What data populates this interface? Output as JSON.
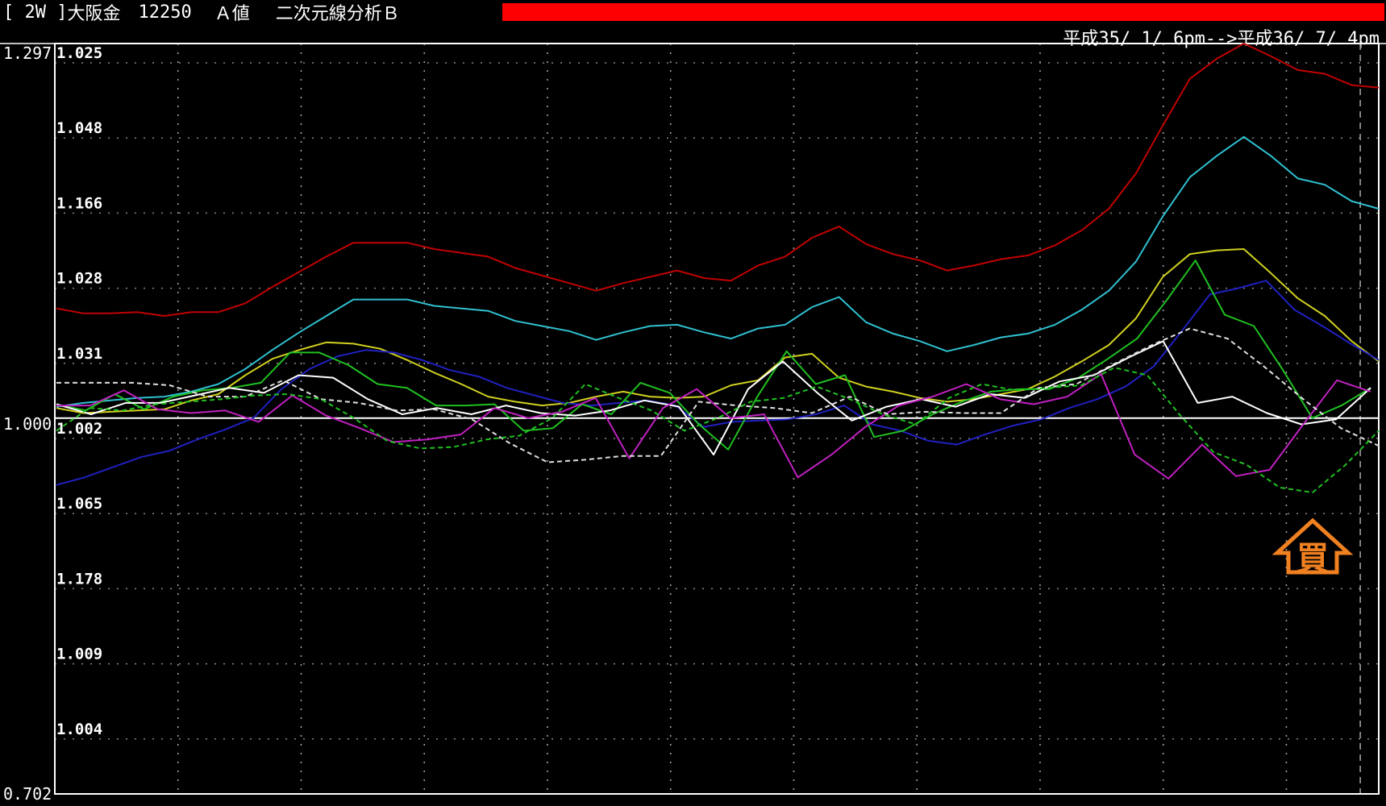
{
  "header": {
    "bracket": "[ 2W ]",
    "instrument": "大阪金",
    "code": "12250",
    "value_type": "Ａ値",
    "analysis": "二次元線分析Ｂ",
    "period": "平成35/ 1/ 6pm-->平成36/ 7/ 4pm",
    "accent_color": "#ff0000"
  },
  "scale": {
    "top": "1.297",
    "mid": "1.000",
    "bottom": "0.702"
  },
  "buy_marker": {
    "label": "買",
    "color": "#f08020"
  },
  "chart_data": {
    "type": "line",
    "title": "",
    "ylim": [
      0.702,
      1.297
    ],
    "y_tick_labels": [
      "1.025",
      "1.048",
      "1.166",
      "1.028",
      "1.031",
      "1.002",
      "1.065",
      "1.178",
      "1.009",
      "1.004"
    ],
    "grid": true,
    "reference_line": 1.0,
    "series": [
      {
        "color": "#c00000",
        "dash": false,
        "values": [
          1.087,
          1.083,
          1.083,
          1.084,
          1.081,
          1.084,
          1.084,
          1.091,
          1.104,
          1.116,
          1.128,
          1.139,
          1.139,
          1.139,
          1.134,
          1.131,
          1.128,
          1.119,
          1.113,
          1.107,
          1.101,
          1.107,
          1.112,
          1.117,
          1.111,
          1.109,
          1.121,
          1.128,
          1.143,
          1.152,
          1.138,
          1.13,
          1.125,
          1.117,
          1.121,
          1.126,
          1.129,
          1.137,
          1.149,
          1.166,
          1.194,
          1.232,
          1.269,
          1.285,
          1.297,
          1.287,
          1.276,
          1.273,
          1.264,
          1.262
        ]
      },
      {
        "color": "#30c0d0",
        "dash": false,
        "values": [
          1.009,
          1.012,
          1.014,
          1.016,
          1.017,
          1.021,
          1.027,
          1.039,
          1.054,
          1.068,
          1.081,
          1.094,
          1.094,
          1.094,
          1.089,
          1.087,
          1.085,
          1.077,
          1.073,
          1.069,
          1.062,
          1.068,
          1.073,
          1.074,
          1.068,
          1.063,
          1.071,
          1.074,
          1.088,
          1.096,
          1.076,
          1.067,
          1.061,
          1.053,
          1.058,
          1.064,
          1.067,
          1.074,
          1.086,
          1.101,
          1.124,
          1.16,
          1.191,
          1.208,
          1.223,
          1.208,
          1.19,
          1.185,
          1.172,
          1.166
        ]
      },
      {
        "color": "#d0d020",
        "dash": false,
        "values": [
          1.008,
          1.004,
          1.005,
          1.006,
          1.007,
          1.014,
          1.019,
          1.034,
          1.047,
          1.054,
          1.06,
          1.059,
          1.055,
          1.046,
          1.036,
          1.027,
          1.017,
          1.013,
          1.01,
          1.012,
          1.017,
          1.021,
          1.017,
          1.016,
          1.017,
          1.026,
          1.03,
          1.048,
          1.051,
          1.032,
          1.025,
          1.021,
          1.016,
          1.013,
          1.015,
          1.019,
          1.023,
          1.033,
          1.045,
          1.058,
          1.079,
          1.112,
          1.13,
          1.133,
          1.134,
          1.115,
          1.095,
          1.081,
          1.061,
          1.045
        ]
      },
      {
        "color": "#2020c0",
        "dash": false,
        "values": [
          0.947,
          0.953,
          0.961,
          0.969,
          0.974,
          0.983,
          0.991,
          1.0,
          1.023,
          1.039,
          1.049,
          1.054,
          1.052,
          1.046,
          1.038,
          1.033,
          1.024,
          1.018,
          1.012,
          1.01,
          1.012,
          1.014,
          1.01,
          0.993,
          0.997,
          0.998,
          0.999,
          1.003,
          1.01,
          0.995,
          0.99,
          0.982,
          0.979,
          0.987,
          0.994,
          0.999,
          1.008,
          1.015,
          1.025,
          1.041,
          1.069,
          1.098,
          1.103,
          1.109,
          1.086,
          1.073,
          1.059,
          1.046
        ]
      },
      {
        "color": "#20c020",
        "dash": false,
        "values": [
          1.011,
          1.006,
          1.019,
          1.007,
          1.017,
          1.022,
          1.024,
          1.028,
          1.052,
          1.052,
          1.042,
          1.027,
          1.024,
          1.01,
          1.01,
          1.011,
          0.99,
          0.992,
          1.011,
          1.003,
          1.028,
          1.02,
          0.995,
          0.975,
          1.017,
          1.053,
          1.027,
          1.034,
          0.985,
          0.99,
          1.003,
          1.013,
          1.021,
          1.023,
          1.023,
          1.032,
          1.047,
          1.063,
          1.093,
          1.125,
          1.082,
          1.073,
          1.038,
          1.0,
          1.01,
          1.024
        ]
      },
      {
        "color": "#ffffff",
        "dash": false,
        "values": [
          1.011,
          1.003,
          1.012,
          1.012,
          1.018,
          1.024,
          1.02,
          1.034,
          1.032,
          1.015,
          1.003,
          1.008,
          1.003,
          1.01,
          1.004,
          1.002,
          1.006,
          1.014,
          1.009,
          0.971,
          1.023,
          1.045,
          1.02,
          0.998,
          1.009,
          1.015,
          1.009,
          1.019,
          1.016,
          1.029,
          1.034,
          1.048,
          1.061,
          1.012,
          1.017,
          1.004,
          0.995,
          0.999,
          1.024
        ]
      },
      {
        "color": "#c020c0",
        "dash": false,
        "values": [
          1.01,
          1.01,
          1.022,
          1.007,
          1.004,
          1.006,
          0.997,
          1.018,
          1.002,
          0.992,
          0.981,
          0.983,
          0.987,
          1.008,
          1.0,
          1.005,
          1.016,
          0.968,
          1.008,
          1.023,
          1.0,
          1.003,
          0.953,
          0.971,
          0.993,
          1.01,
          1.017,
          1.027,
          1.015,
          1.011,
          1.017,
          1.035,
          0.971,
          0.952,
          0.979,
          0.954,
          0.959,
          0.995,
          1.03,
          1.021
        ]
      },
      {
        "color": "#e0e0e0",
        "dash": true,
        "values": [
          1.028,
          1.028,
          1.028,
          1.026,
          1.017,
          1.017,
          1.03,
          1.015,
          1.012,
          1.006,
          1.007,
          0.999,
          0.98,
          0.965,
          0.967,
          0.97,
          0.97,
          1.013,
          1.01,
          1.008,
          1.004,
          1.017,
          1.003,
          1.005,
          1.004,
          1.004,
          1.024,
          1.027,
          1.043,
          1.058,
          1.071,
          1.063,
          1.04,
          1.015,
          0.992,
          0.978
        ]
      },
      {
        "color": "#20c020",
        "dash": true,
        "values": [
          0.99,
          1.008,
          1.006,
          1.011,
          1.013,
          1.015,
          1.018,
          1.019,
          1.015,
          1.0,
          0.982,
          0.976,
          0.977,
          0.983,
          0.986,
          1.0,
          1.027,
          1.016,
          1.006,
          0.99,
          1.0,
          1.013,
          1.016,
          1.025,
          1.015,
          1.003,
          0.995,
          1.016,
          1.027,
          1.022,
          1.024,
          1.026,
          1.04,
          1.034,
          1.002,
          0.973,
          0.963,
          0.945,
          0.941,
          0.963,
          0.99
        ]
      }
    ]
  }
}
